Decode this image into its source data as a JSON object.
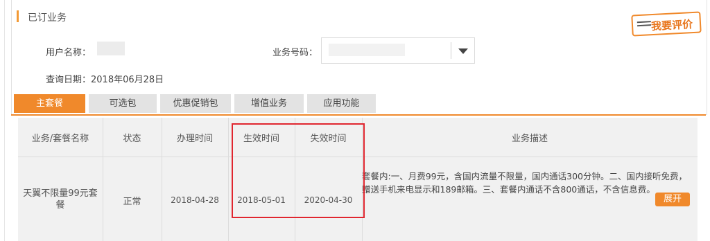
{
  "section": {
    "title": "已订业务"
  },
  "rate_button": {
    "label": "我要评价",
    "icon": "pen-lines-icon"
  },
  "fields": {
    "user_name_label": "用户名称：",
    "service_number_label": "业务号码：",
    "query_date_label": "查询日期：",
    "query_date_value": "2018年06月28日"
  },
  "tabs": [
    {
      "label": "主套餐",
      "active": true
    },
    {
      "label": "可选包",
      "active": false
    },
    {
      "label": "优惠促销包",
      "active": false
    },
    {
      "label": "增值业务",
      "active": false
    },
    {
      "label": "应用功能",
      "active": false
    }
  ],
  "table": {
    "headers": [
      "业务/套餐名称",
      "状态",
      "办理时间",
      "生效时间",
      "失效时间",
      "业务描述"
    ],
    "rows": [
      {
        "name": "天翼不限量99元套餐",
        "status": "正常",
        "handle_time": "2018-04-28",
        "effective_time": "2018-05-01",
        "expiry_time": "2020-04-30",
        "description": "套餐内:一、月费99元，含国内流量不限量，国内通话300分钟。二、国内接听免费，赠送手机来电显示和189邮箱。三、套餐内通话不含800通话，不含信息费。",
        "expand_label": "展开"
      }
    ]
  },
  "colors": {
    "accent": "#f0892b",
    "highlight": "#e0262f"
  }
}
